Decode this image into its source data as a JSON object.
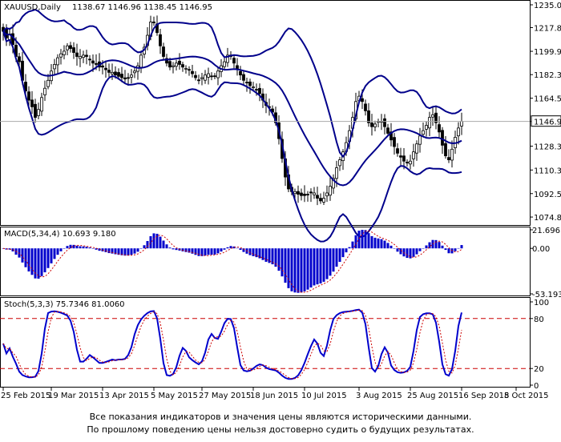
{
  "header": {
    "symbol": "XAUUSD,Daily",
    "ohlc": "1138.67 1146.96 1138.45 1146.95"
  },
  "colors": {
    "bands": "#00008b",
    "candle": "#000000",
    "hist": "#0000cc",
    "signal": "#cc0000",
    "stoch_main": "#0000cc",
    "stoch_signal": "#cc0000",
    "level": "#cc0000"
  },
  "chart_data": [
    {
      "type": "candlestick",
      "label": "XAUUSD,Daily",
      "ylim": [
        1070,
        1235
      ],
      "y_ticks": [
        1235.0,
        1217.8,
        1199.9,
        1182.3,
        1164.5,
        1146.95,
        1128.3,
        1110.3,
        1092.5,
        1074.8
      ],
      "y_tick_labels": [
        "1235.0",
        "1217.80",
        "1199.90",
        "1182.30",
        "1164.50",
        "1146.95",
        "1128.30",
        "1110.30",
        "1092.50",
        "1074.80"
      ],
      "last_price": 1146.95,
      "last_price_label": "1146.95",
      "close": [
        1215,
        1210,
        1213,
        1205,
        1196,
        1192,
        1178,
        1170,
        1163,
        1158,
        1150,
        1156,
        1165,
        1172,
        1178,
        1185,
        1190,
        1195,
        1198,
        1200,
        1204,
        1202,
        1199,
        1196,
        1196,
        1197,
        1196,
        1194,
        1191,
        1190,
        1188,
        1188,
        1186,
        1184,
        1184,
        1182,
        1181,
        1180,
        1179,
        1180,
        1182,
        1185,
        1189,
        1197,
        1203,
        1212,
        1222,
        1222,
        1214,
        1204,
        1196,
        1191,
        1188,
        1189,
        1191,
        1190,
        1188,
        1187,
        1186,
        1183,
        1180,
        1178,
        1180,
        1182,
        1183,
        1181,
        1181,
        1185,
        1189,
        1192,
        1197,
        1196,
        1191,
        1186,
        1182,
        1178,
        1176,
        1174,
        1173,
        1171,
        1168,
        1163,
        1159,
        1158,
        1154,
        1146,
        1134,
        1119,
        1105,
        1096,
        1094,
        1094,
        1092,
        1091,
        1091,
        1092,
        1093,
        1093,
        1089,
        1087,
        1089,
        1093,
        1098,
        1104,
        1112,
        1118,
        1124,
        1131,
        1140,
        1150,
        1162,
        1166,
        1162,
        1155,
        1146,
        1143,
        1145,
        1147,
        1147,
        1143,
        1138,
        1133,
        1128,
        1123,
        1120,
        1117,
        1116,
        1117,
        1124,
        1130,
        1136,
        1140,
        1144,
        1150,
        1152,
        1146,
        1139,
        1129,
        1121,
        1118,
        1126,
        1135,
        1142,
        1147
      ],
      "bands": {
        "period": 20,
        "deviation": 2,
        "color": "#00008b"
      }
    },
    {
      "type": "histogram",
      "label": "MACD(5,34,4) 10.693 9.180",
      "ylim": [
        -53.193,
        21.696
      ],
      "y_ticks": [
        21.696,
        0.0,
        -53.193
      ],
      "y_tick_labels": [
        "21.696",
        "0.00",
        "-53.193"
      ],
      "fast": 5,
      "slow": 34,
      "signal": 4,
      "last_macd": 10.693,
      "last_signal": 9.18
    },
    {
      "type": "line",
      "label": "Stoch(5,3,3) 75.7346 81.0060",
      "ylim": [
        0,
        100
      ],
      "y_ticks": [
        100,
        80,
        20,
        0
      ],
      "y_tick_labels": [
        "100",
        "80",
        "20",
        "0"
      ],
      "levels": [
        80,
        20
      ],
      "k": 5,
      "d": 3,
      "slowing": 3,
      "last_main": 75.7346,
      "last_signal": 81.006
    }
  ],
  "x_labels": [
    {
      "i": 0,
      "text": "25 Feb 2015"
    },
    {
      "i": 15,
      "text": "19 Mar 2015"
    },
    {
      "i": 31,
      "text": "13 Apr 2015"
    },
    {
      "i": 47,
      "text": "5 May 2015"
    },
    {
      "i": 62,
      "text": "27 May 2015"
    },
    {
      "i": 78,
      "text": "18 Jun 2015"
    },
    {
      "i": 94,
      "text": "10 Jul 2015"
    },
    {
      "i": 111,
      "text": "3 Aug 2015"
    },
    {
      "i": 127,
      "text": "25 Aug 2015"
    },
    {
      "i": 143,
      "text": "16 Sep 2015"
    },
    {
      "i": 160,
      "text": "8 Oct 2015"
    }
  ],
  "footer": {
    "line1": "Все показания индикаторов и значения цены являются историческими данными.",
    "line2": "По прошлому поведению цены нельзя достоверно судить о будущих результатах."
  }
}
